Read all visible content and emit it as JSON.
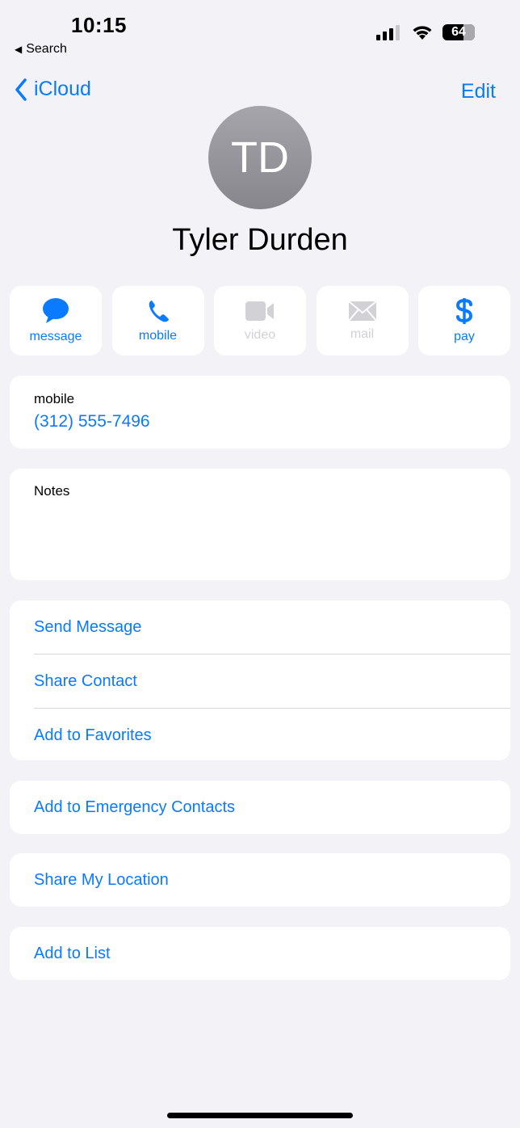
{
  "status_bar": {
    "time": "10:15",
    "back_app": "Search",
    "battery": "64",
    "icons": [
      "cellular-signal-icon",
      "wifi-icon",
      "battery-icon"
    ]
  },
  "nav": {
    "back_label": "iCloud",
    "edit_label": "Edit"
  },
  "contact": {
    "initials": "TD",
    "name": "Tyler Durden"
  },
  "actions": [
    {
      "label": "message",
      "icon": "message-bubble-icon",
      "enabled": true
    },
    {
      "label": "mobile",
      "icon": "phone-icon",
      "enabled": true
    },
    {
      "label": "video",
      "icon": "video-camera-icon",
      "enabled": false
    },
    {
      "label": "mail",
      "icon": "envelope-icon",
      "enabled": false
    },
    {
      "label": "pay",
      "icon": "dollar-icon",
      "enabled": true
    }
  ],
  "phone_section": {
    "label": "mobile",
    "number": "(312) 555-7496"
  },
  "notes": {
    "label": "Notes",
    "value": ""
  },
  "options_group": [
    "Send Message",
    "Share Contact",
    "Add to Favorites"
  ],
  "emergency": "Add to Emergency Contacts",
  "share_location": "Share My Location",
  "add_to_list": "Add to List",
  "colors": {
    "accent": "#0a7aff",
    "background": "#f2f2f7",
    "disabled": "#d1d1d6"
  }
}
